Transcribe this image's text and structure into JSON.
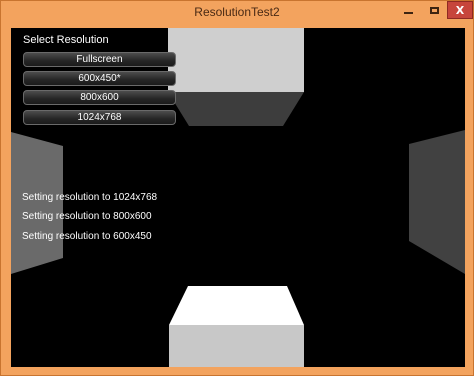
{
  "window": {
    "title": "ResolutionTest2",
    "controls": {
      "minimize_icon": "minimize-icon",
      "maximize_icon": "maximize-icon",
      "close_label": "X"
    },
    "accent_color": "#f3a35e",
    "close_color": "#c7453b"
  },
  "menu": {
    "heading": "Select Resolution",
    "buttons": [
      "Fullscreen",
      "600x450*",
      "800x600",
      "1024x768"
    ]
  },
  "log": [
    "Setting resolution to 1024x768",
    "Setting resolution to 800x600",
    "Setting resolution to 600x450"
  ]
}
